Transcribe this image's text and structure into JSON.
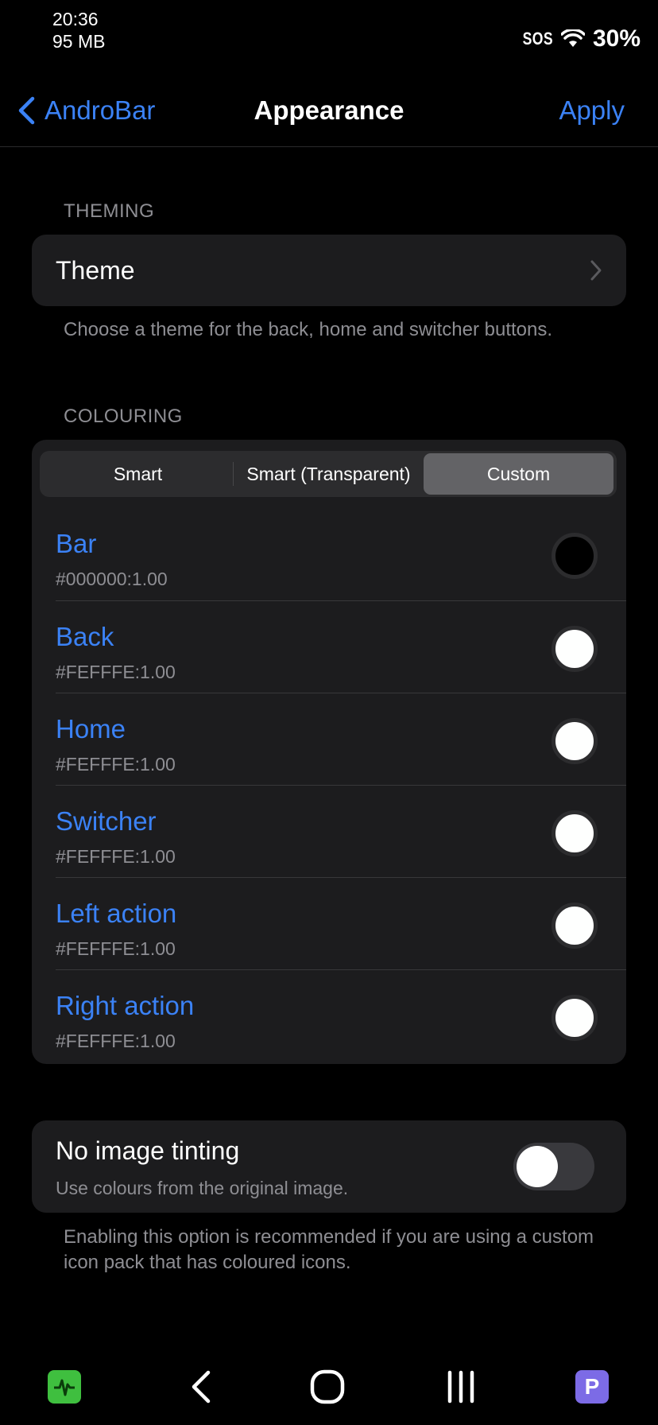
{
  "status_bar": {
    "time": "20:36",
    "memory": "95 MB",
    "sos": "SOS",
    "battery": "30%"
  },
  "nav": {
    "back_label": "AndroBar",
    "title": "Appearance",
    "apply_label": "Apply"
  },
  "theming": {
    "header": "THEMING",
    "theme_label": "Theme",
    "footer": "Choose a theme for the back, home and switcher buttons."
  },
  "colouring": {
    "header": "COLOURING",
    "segments": [
      "Smart",
      "Smart (Transparent)",
      "Custom"
    ],
    "selected_segment": "Custom",
    "items": [
      {
        "name": "Bar",
        "value": "#000000:1.00",
        "swatch": "#000000"
      },
      {
        "name": "Back",
        "value": "#FEFFFE:1.00",
        "swatch": "#FEFFFE"
      },
      {
        "name": "Home",
        "value": "#FEFFFE:1.00",
        "swatch": "#FEFFFE"
      },
      {
        "name": "Switcher",
        "value": "#FEFFFE:1.00",
        "swatch": "#FEFFFE"
      },
      {
        "name": "Left action",
        "value": "#FEFFFE:1.00",
        "swatch": "#FEFFFE"
      },
      {
        "name": "Right action",
        "value": "#FEFFFE:1.00",
        "swatch": "#FEFFFE"
      }
    ]
  },
  "tinting": {
    "title": "No image tinting",
    "subtitle": "Use colours from the original image.",
    "enabled": false,
    "footer": "Enabling this option is recommended if you are using a custom icon pack that has coloured icons."
  },
  "bottom_nav": {
    "right_app_glyph": "P"
  },
  "colors": {
    "accent": "#3B82F6",
    "background": "#000000",
    "card": "#1C1C1E",
    "secondary_text": "#8E8E93"
  }
}
